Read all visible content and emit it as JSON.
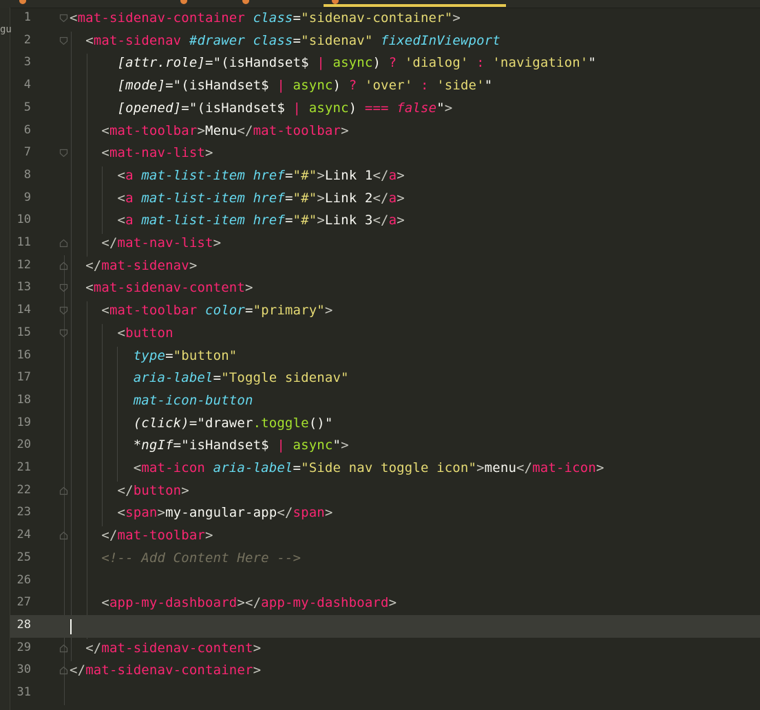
{
  "tab_label_fragment": "gu",
  "current_line": 28,
  "lines": [
    {
      "n": "1",
      "segs": [
        [
          "ang",
          "<"
        ],
        [
          "tag",
          "mat-sidenav-container"
        ],
        [
          "pun",
          " "
        ],
        [
          "attr",
          "class"
        ],
        [
          "pun",
          "="
        ],
        [
          "str",
          "\"sidenav-container\""
        ],
        [
          "gt",
          ">"
        ]
      ]
    },
    {
      "n": "2",
      "segs": [
        [
          "pun",
          "  "
        ],
        [
          "ang",
          "<"
        ],
        [
          "tag",
          "mat-sidenav"
        ],
        [
          "pun",
          " "
        ],
        [
          "attr",
          "#drawer"
        ],
        [
          "pun",
          " "
        ],
        [
          "attr",
          "class"
        ],
        [
          "pun",
          "="
        ],
        [
          "str",
          "\"sidenav\""
        ],
        [
          "pun",
          " "
        ],
        [
          "attr",
          "fixedInViewport"
        ]
      ]
    },
    {
      "n": "3",
      "segs": [
        [
          "pun",
          "      "
        ],
        [
          "ng",
          "[attr.role]"
        ],
        [
          "pun",
          "=\""
        ],
        [
          "pun",
          "(isHandset$ "
        ],
        [
          "op",
          "|"
        ],
        [
          "pun",
          " "
        ],
        [
          "fn",
          "async"
        ],
        [
          "pun",
          ") "
        ],
        [
          "op",
          "?"
        ],
        [
          "pun",
          " "
        ],
        [
          "str",
          "'dialog'"
        ],
        [
          "pun",
          " "
        ],
        [
          "op",
          ":"
        ],
        [
          "pun",
          " "
        ],
        [
          "str",
          "'navigation'"
        ],
        [
          "pun",
          "\""
        ]
      ]
    },
    {
      "n": "4",
      "segs": [
        [
          "pun",
          "      "
        ],
        [
          "ng",
          "[mode]"
        ],
        [
          "pun",
          "=\""
        ],
        [
          "pun",
          "(isHandset$ "
        ],
        [
          "op",
          "|"
        ],
        [
          "pun",
          " "
        ],
        [
          "fn",
          "async"
        ],
        [
          "pun",
          ") "
        ],
        [
          "op",
          "?"
        ],
        [
          "pun",
          " "
        ],
        [
          "str",
          "'over'"
        ],
        [
          "pun",
          " "
        ],
        [
          "op",
          ":"
        ],
        [
          "pun",
          " "
        ],
        [
          "str",
          "'side'"
        ],
        [
          "pun",
          "\""
        ]
      ]
    },
    {
      "n": "5",
      "segs": [
        [
          "pun",
          "      "
        ],
        [
          "ng",
          "[opened]"
        ],
        [
          "pun",
          "=\""
        ],
        [
          "pun",
          "(isHandset$ "
        ],
        [
          "op",
          "|"
        ],
        [
          "pun",
          " "
        ],
        [
          "fn",
          "async"
        ],
        [
          "pun",
          ") "
        ],
        [
          "op",
          "==="
        ],
        [
          "pun",
          " "
        ],
        [
          "bool",
          "false"
        ],
        [
          "pun",
          "\""
        ],
        [
          "gt",
          ">"
        ]
      ]
    },
    {
      "n": "6",
      "segs": [
        [
          "pun",
          "    "
        ],
        [
          "ang",
          "<"
        ],
        [
          "tag",
          "mat-toolbar"
        ],
        [
          "gt",
          ">"
        ],
        [
          "txt",
          "Menu"
        ],
        [
          "ang",
          "</"
        ],
        [
          "tag",
          "mat-toolbar"
        ],
        [
          "gt",
          ">"
        ]
      ]
    },
    {
      "n": "7",
      "segs": [
        [
          "pun",
          "    "
        ],
        [
          "ang",
          "<"
        ],
        [
          "tag",
          "mat-nav-list"
        ],
        [
          "gt",
          ">"
        ]
      ]
    },
    {
      "n": "8",
      "segs": [
        [
          "pun",
          "      "
        ],
        [
          "ang",
          "<"
        ],
        [
          "tag",
          "a"
        ],
        [
          "pun",
          " "
        ],
        [
          "attr",
          "mat-list-item"
        ],
        [
          "pun",
          " "
        ],
        [
          "attr",
          "href"
        ],
        [
          "pun",
          "="
        ],
        [
          "str",
          "\"#\""
        ],
        [
          "gt",
          ">"
        ],
        [
          "txt",
          "Link 1"
        ],
        [
          "ang",
          "</"
        ],
        [
          "tag",
          "a"
        ],
        [
          "gt",
          ">"
        ]
      ]
    },
    {
      "n": "9",
      "segs": [
        [
          "pun",
          "      "
        ],
        [
          "ang",
          "<"
        ],
        [
          "tag",
          "a"
        ],
        [
          "pun",
          " "
        ],
        [
          "attr",
          "mat-list-item"
        ],
        [
          "pun",
          " "
        ],
        [
          "attr",
          "href"
        ],
        [
          "pun",
          "="
        ],
        [
          "str",
          "\"#\""
        ],
        [
          "gt",
          ">"
        ],
        [
          "txt",
          "Link 2"
        ],
        [
          "ang",
          "</"
        ],
        [
          "tag",
          "a"
        ],
        [
          "gt",
          ">"
        ]
      ]
    },
    {
      "n": "10",
      "segs": [
        [
          "pun",
          "      "
        ],
        [
          "ang",
          "<"
        ],
        [
          "tag",
          "a"
        ],
        [
          "pun",
          " "
        ],
        [
          "attr",
          "mat-list-item"
        ],
        [
          "pun",
          " "
        ],
        [
          "attr",
          "href"
        ],
        [
          "pun",
          "="
        ],
        [
          "str",
          "\"#\""
        ],
        [
          "gt",
          ">"
        ],
        [
          "txt",
          "Link 3"
        ],
        [
          "ang",
          "</"
        ],
        [
          "tag",
          "a"
        ],
        [
          "gt",
          ">"
        ]
      ]
    },
    {
      "n": "11",
      "segs": [
        [
          "pun",
          "    "
        ],
        [
          "ang",
          "</"
        ],
        [
          "tag",
          "mat-nav-list"
        ],
        [
          "gt",
          ">"
        ]
      ]
    },
    {
      "n": "12",
      "segs": [
        [
          "pun",
          "  "
        ],
        [
          "ang",
          "</"
        ],
        [
          "tag",
          "mat-sidenav"
        ],
        [
          "gt",
          ">"
        ]
      ]
    },
    {
      "n": "13",
      "segs": [
        [
          "pun",
          "  "
        ],
        [
          "ang",
          "<"
        ],
        [
          "tag",
          "mat-sidenav-content"
        ],
        [
          "gt",
          ">"
        ]
      ]
    },
    {
      "n": "14",
      "segs": [
        [
          "pun",
          "    "
        ],
        [
          "ang",
          "<"
        ],
        [
          "tag",
          "mat-toolbar"
        ],
        [
          "pun",
          " "
        ],
        [
          "attr",
          "color"
        ],
        [
          "pun",
          "="
        ],
        [
          "str",
          "\"primary\""
        ],
        [
          "gt",
          ">"
        ]
      ]
    },
    {
      "n": "15",
      "segs": [
        [
          "pun",
          "      "
        ],
        [
          "ang",
          "<"
        ],
        [
          "tag",
          "button"
        ]
      ]
    },
    {
      "n": "16",
      "segs": [
        [
          "pun",
          "        "
        ],
        [
          "attr",
          "type"
        ],
        [
          "pun",
          "="
        ],
        [
          "str",
          "\"button\""
        ]
      ]
    },
    {
      "n": "17",
      "segs": [
        [
          "pun",
          "        "
        ],
        [
          "attr",
          "aria-label"
        ],
        [
          "pun",
          "="
        ],
        [
          "str",
          "\"Toggle sidenav\""
        ]
      ]
    },
    {
      "n": "18",
      "segs": [
        [
          "pun",
          "        "
        ],
        [
          "attr",
          "mat-icon-button"
        ]
      ]
    },
    {
      "n": "19",
      "segs": [
        [
          "pun",
          "        "
        ],
        [
          "ng",
          "(click)"
        ],
        [
          "pun",
          "=\""
        ],
        [
          "pun",
          "drawer"
        ],
        [
          "fn",
          ".toggle"
        ],
        [
          "pun",
          "()\""
        ]
      ]
    },
    {
      "n": "20",
      "segs": [
        [
          "pun",
          "        "
        ],
        [
          "ng",
          "*ngIf"
        ],
        [
          "pun",
          "=\""
        ],
        [
          "pun",
          "isHandset$ "
        ],
        [
          "op",
          "|"
        ],
        [
          "pun",
          " "
        ],
        [
          "fn",
          "async"
        ],
        [
          "pun",
          "\""
        ],
        [
          "gt",
          ">"
        ]
      ]
    },
    {
      "n": "21",
      "segs": [
        [
          "pun",
          "        "
        ],
        [
          "ang",
          "<"
        ],
        [
          "tag",
          "mat-icon"
        ],
        [
          "pun",
          " "
        ],
        [
          "attr",
          "aria-label"
        ],
        [
          "pun",
          "="
        ],
        [
          "str",
          "\"Side nav toggle icon\""
        ],
        [
          "gt",
          ">"
        ],
        [
          "txt",
          "menu"
        ],
        [
          "ang",
          "</"
        ],
        [
          "tag",
          "mat-icon"
        ],
        [
          "gt",
          ">"
        ]
      ]
    },
    {
      "n": "22",
      "segs": [
        [
          "pun",
          "      "
        ],
        [
          "ang",
          "</"
        ],
        [
          "tag",
          "button"
        ],
        [
          "gt",
          ">"
        ]
      ]
    },
    {
      "n": "23",
      "segs": [
        [
          "pun",
          "      "
        ],
        [
          "ang",
          "<"
        ],
        [
          "tag",
          "span"
        ],
        [
          "gt",
          ">"
        ],
        [
          "txt",
          "my-angular-app"
        ],
        [
          "ang",
          "</"
        ],
        [
          "tag",
          "span"
        ],
        [
          "gt",
          ">"
        ]
      ]
    },
    {
      "n": "24",
      "segs": [
        [
          "pun",
          "    "
        ],
        [
          "ang",
          "</"
        ],
        [
          "tag",
          "mat-toolbar"
        ],
        [
          "gt",
          ">"
        ]
      ]
    },
    {
      "n": "25",
      "segs": [
        [
          "pun",
          "    "
        ],
        [
          "cmt",
          "<!-- Add Content Here -->"
        ]
      ]
    },
    {
      "n": "26",
      "segs": []
    },
    {
      "n": "27",
      "segs": [
        [
          "pun",
          "    "
        ],
        [
          "ang",
          "<"
        ],
        [
          "tag",
          "app-my-dashboard"
        ],
        [
          "gt",
          ">"
        ],
        [
          "ang",
          "</"
        ],
        [
          "tag",
          "app-my-dashboard"
        ],
        [
          "gt",
          ">"
        ]
      ]
    },
    {
      "n": "28",
      "segs": []
    },
    {
      "n": "29",
      "segs": [
        [
          "pun",
          "  "
        ],
        [
          "ang",
          "</"
        ],
        [
          "tag",
          "mat-sidenav-content"
        ],
        [
          "gt",
          ">"
        ]
      ]
    },
    {
      "n": "30",
      "segs": [
        [
          "ang",
          "</"
        ],
        [
          "tag",
          "mat-sidenav-container"
        ],
        [
          "gt",
          ">"
        ]
      ]
    },
    {
      "n": "31",
      "segs": []
    }
  ],
  "fold_markers": {
    "1": "open",
    "2": "open",
    "7": "open",
    "11": "close",
    "12": "close",
    "13": "open",
    "14": "open",
    "15": "open",
    "22": "close",
    "24": "close",
    "29": "close",
    "30": "close"
  },
  "colors": {
    "background": "#272822",
    "tag": "#F92672",
    "attribute": "#66D9EF",
    "string": "#E6DB74",
    "function": "#A6E22E",
    "comment": "#75715E",
    "text": "#F8F8F2",
    "current_line": "#3b3c36",
    "tab_indicator": "#e6c84f"
  },
  "icons": {
    "fold_open": "fold-open-icon",
    "fold_close": "fold-close-icon"
  }
}
